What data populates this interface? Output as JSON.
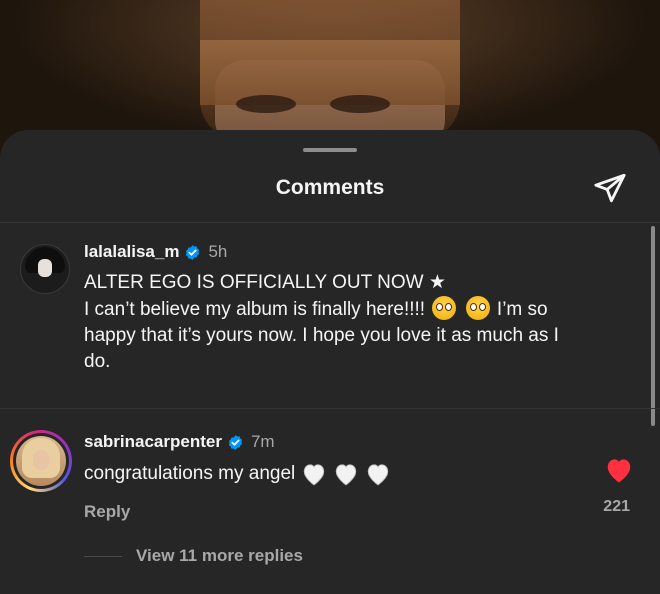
{
  "sheet": {
    "title": "Comments"
  },
  "caption": {
    "username": "lalalalisa_m",
    "time": "5h",
    "line1": "ALTER EGO IS OFFICIALLY OUT NOW ★",
    "line2_a": "I can’t believe my album is finally here!!!! ",
    "line2_b": " I’m so",
    "line3": "happy that it’s yours now. I hope you love it as much as I",
    "line4": "do.",
    "emoji": "pleading-face-icon"
  },
  "comment": {
    "username": "sabrinacarpenter",
    "time": "7m",
    "text": "congratulations my angel",
    "emoji": "white-heart-icon",
    "reply_label": "Reply",
    "like_count": "221",
    "liked": true
  },
  "view_replies": {
    "label": "View 11 more replies"
  },
  "colors": {
    "sheet_bg": "#262626",
    "verified_blue": "#0095f6",
    "like_red": "#ff3040",
    "secondary_text": "#a8a8a8"
  }
}
